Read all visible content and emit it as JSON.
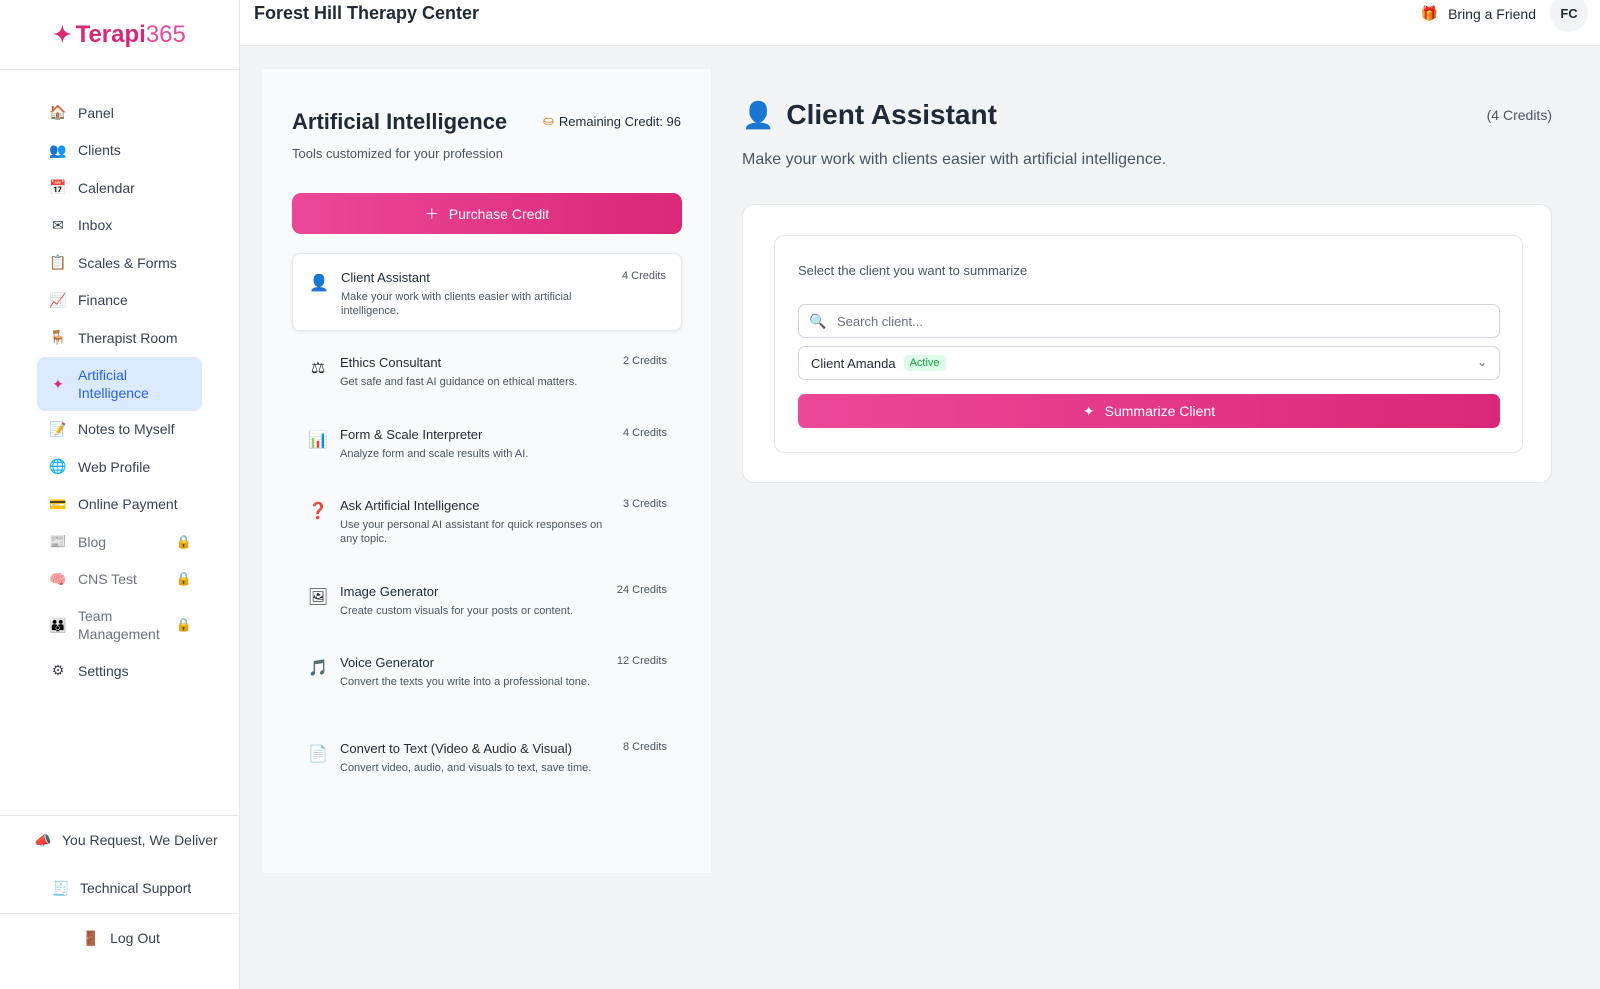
{
  "brand": {
    "name_a": "Terapi",
    "name_b": "365"
  },
  "header": {
    "title": "Forest Hill Therapy Center",
    "friend_label": "Bring a Friend",
    "avatar_initials": "FC"
  },
  "sidebar": {
    "items": [
      {
        "label": "Panel",
        "icon": "house-icon"
      },
      {
        "label": "Clients",
        "icon": "clients-icon"
      },
      {
        "label": "Calendar",
        "icon": "calendar-icon"
      },
      {
        "label": "Inbox",
        "icon": "mail-icon"
      },
      {
        "label": "Scales & Forms",
        "icon": "forms-icon"
      },
      {
        "label": "Finance",
        "icon": "chart-icon"
      },
      {
        "label": "Therapist Room",
        "icon": "room-icon"
      },
      {
        "label": "Artificial Intelligence",
        "icon": "sparkle-icon",
        "active": true
      },
      {
        "label": "Notes to Myself",
        "icon": "notes-icon"
      },
      {
        "label": "Web Profile",
        "icon": "globe-icon"
      },
      {
        "label": "Online Payment",
        "icon": "card-icon"
      },
      {
        "label": "Blog",
        "icon": "blog-icon",
        "locked": true
      },
      {
        "label": "CNS Test",
        "icon": "brain-icon",
        "locked": true
      },
      {
        "label": "Team Management",
        "icon": "team-icon",
        "locked": true
      },
      {
        "label": "Settings",
        "icon": "gear-icon"
      }
    ],
    "request_label": "You Request, We Deliver",
    "support_label": "Technical Support",
    "logout_label": "Log Out"
  },
  "tools_panel": {
    "title": "Artificial Intelligence",
    "subtitle": "Tools customized for your profession",
    "remaining_credit": "Remaining Credit: 96",
    "purchase_label": "Purchase Credit",
    "tools": [
      {
        "name": "Client Assistant",
        "desc": "Make your work with clients easier with artificial intelligence.",
        "credits": "4 Credits",
        "selected": true
      },
      {
        "name": "Ethics Consultant",
        "desc": "Get safe and fast AI guidance on ethical matters.",
        "credits": "2 Credits"
      },
      {
        "name": "Form & Scale Interpreter",
        "desc": "Analyze form and scale results with AI.",
        "credits": "4 Credits"
      },
      {
        "name": "Ask Artificial Intelligence",
        "desc": "Use your personal AI assistant for quick responses on any topic.",
        "credits": "3 Credits"
      },
      {
        "name": "Image Generator",
        "desc": "Create custom visuals for your posts or content.",
        "credits": "24 Credits"
      },
      {
        "name": "Voice Generator",
        "desc": "Convert the texts you write into a professional tone.",
        "credits": "12 Credits"
      },
      {
        "name": "Convert to Text (Video & Audio & Visual)",
        "desc": "Convert video, audio, and visuals to text, save time.",
        "credits": "8 Credits"
      }
    ]
  },
  "main": {
    "title": "Client Assistant",
    "credits": "(4 Credits)",
    "subtitle": "Make your work with clients easier with artificial intelligence.",
    "select_label": "Select the client you want to summarize",
    "search_placeholder": "Search client...",
    "selected_client": "Client Amanda",
    "client_status": "Active",
    "summarize_label": "Summarize Client"
  },
  "colors": {
    "accent": "#db2777",
    "active_nav_bg": "#dbeafe",
    "active_nav_text": "#2563eb"
  }
}
